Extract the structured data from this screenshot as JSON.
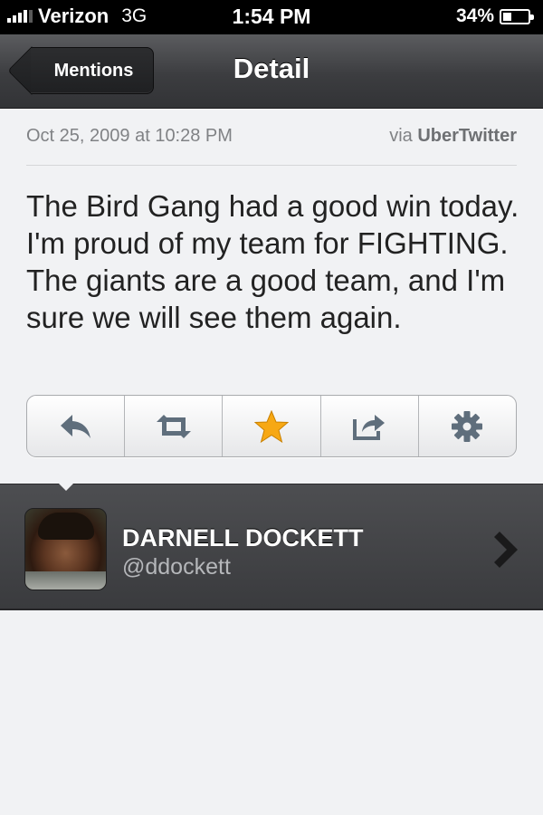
{
  "status_bar": {
    "carrier": "Verizon",
    "network": "3G",
    "time": "1:54 PM",
    "battery": "34%",
    "battery_level": 0.34
  },
  "nav": {
    "back_label": "Mentions",
    "title": "Detail"
  },
  "tweet": {
    "date": "Oct 25, 2009 at 10:28 PM",
    "via_prefix": "via",
    "via_client": "UberTwitter",
    "text": "The Bird Gang had a good win today. I'm proud of my team for FIGHTING. The giants are a good team, and I'm sure we will see them again."
  },
  "actions": [
    {
      "icon": "reply-icon"
    },
    {
      "icon": "retweet-icon"
    },
    {
      "icon": "star-icon",
      "color": "#f7a814"
    },
    {
      "icon": "share-icon"
    },
    {
      "icon": "gear-icon"
    }
  ],
  "user": {
    "name": "DARNELL DOCKETT",
    "handle": "@ddockett"
  }
}
